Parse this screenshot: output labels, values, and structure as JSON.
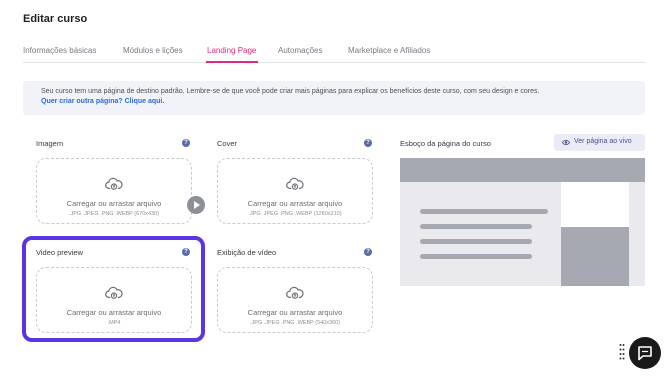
{
  "page": {
    "title": "Editar curso"
  },
  "tabs": [
    {
      "label": "Informações básicas",
      "active": false
    },
    {
      "label": "Módulos e lições",
      "active": false
    },
    {
      "label": "Landing Page",
      "active": true
    },
    {
      "label": "Automações",
      "active": false
    },
    {
      "label": "Marketplace e Afiliados",
      "active": false
    }
  ],
  "info_banner": {
    "text": "Seu curso tem uma página de destino padrão. Lembre-se de que você pode criar mais páginas para explicar os benefícios deste curso, com seu design e cores.",
    "link": "Quer criar outra página? Clique aqui."
  },
  "upload_fields": {
    "imagem": {
      "label": "Imagem",
      "title": "Carregar ou arrastar arquivo",
      "formats": ".JPG .JPEG .PNG .WEBP (670x430)"
    },
    "cover": {
      "label": "Cover",
      "title": "Carregar ou arrastar arquivo",
      "formats": ".JPG .JPEG .PNG .WEBP (1280x210)"
    },
    "video_preview": {
      "label": "Video preview",
      "title": "Carregar ou arrastar arquivo",
      "formats": ".MP4"
    },
    "exibicao_video": {
      "label": "Exibição de vídeo",
      "title": "Carregar ou arrastar arquivo",
      "formats": ".JPG .JPEG .PNG .WEBP (540x360)"
    }
  },
  "help_icon_glyph": "?",
  "course_sketch": {
    "label": "Esboço da página do curso",
    "preview_button": "Ver página ao vivo"
  },
  "colors": {
    "accent": "#e4287c",
    "highlight": "#5b35e2",
    "link": "#2b6cd6",
    "help": "#5b6aa8"
  },
  "icons": [
    "upload-cloud-icon",
    "question-icon",
    "eye-icon",
    "play-icon",
    "drag-dots-icon",
    "chat-icon"
  ]
}
